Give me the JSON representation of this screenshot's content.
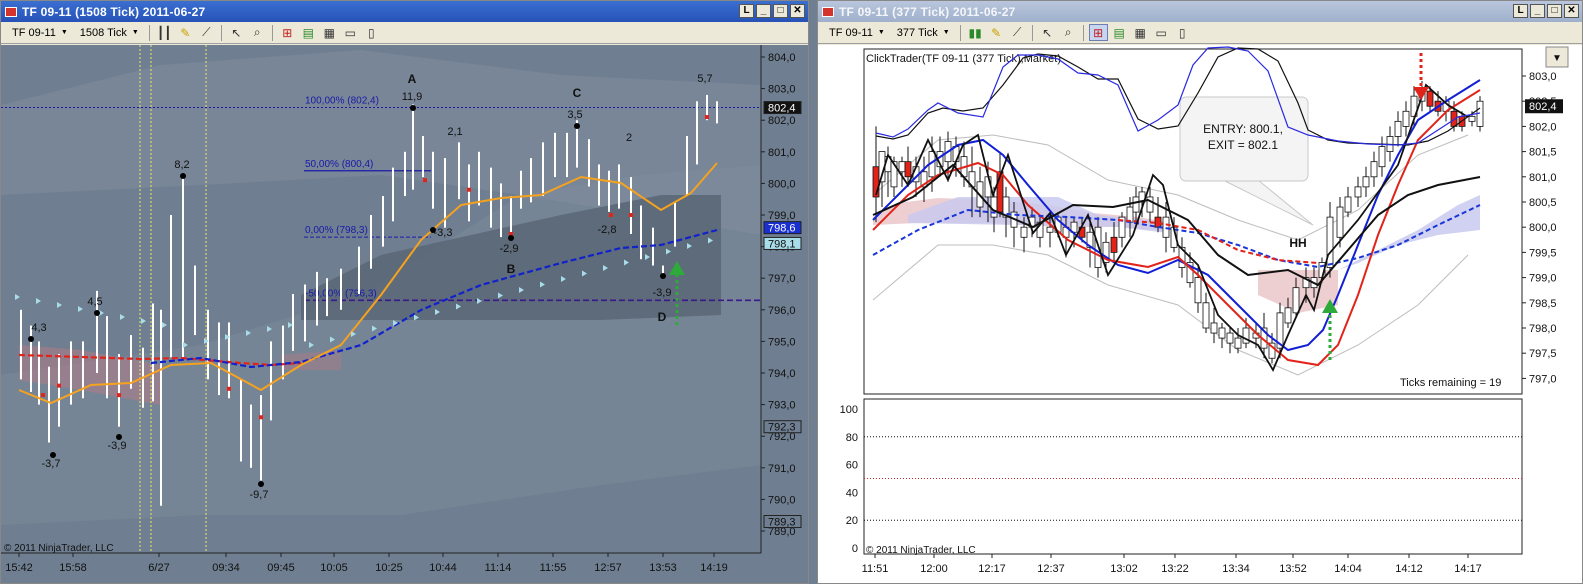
{
  "left_window": {
    "title": "TF 09-11 (1508 Tick)  2011-06-27",
    "toolbar": {
      "instrument": "TF 09-11",
      "period": "1508 Tick"
    },
    "copyright": "© 2011 NinjaTrader, LLC",
    "price_labels": [
      "804,0",
      "803,0",
      "802,0",
      "801,0",
      "800,0",
      "799,0",
      "798,0",
      "797,0",
      "796,0",
      "795,0",
      "794,0",
      "793,0",
      "792,0",
      "791,0",
      "790,0",
      "789,0"
    ],
    "price_boxes": {
      "last": "802,4",
      "blue": "798,6",
      "cyan": "798,1",
      "low1": "792,3",
      "low2": "789,3"
    },
    "time_labels": [
      "15:42",
      "15:58",
      "6/27",
      "09:34",
      "09:45",
      "10:05",
      "10:25",
      "10:44",
      "11:14",
      "11:55",
      "12:57",
      "13:53",
      "14:19"
    ],
    "fib_labels": [
      "100,00% (802,4)",
      "50,00% (800,4)",
      "0,00% (798,3)",
      "-50,00% (796,3)"
    ],
    "swing_labels": [
      "4,3",
      "-3,7",
      "4,5",
      "-3,9",
      "8,2",
      "-9,7",
      "11,9",
      "-3,3",
      "2,1",
      "-2,9",
      "3,5",
      "2",
      "-2,8",
      "-3,9",
      "5,7"
    ],
    "pattern_labels": {
      "a": "A",
      "b": "B",
      "c": "C",
      "d": "D"
    },
    "colors": {
      "bg": "#6f7f91",
      "band_dark": "#5b6878",
      "band_light": "#7f8d9d",
      "orange": "#f5a21f",
      "red_ma": "#e2231a",
      "blue_ma": "#1122cc",
      "purple": "#3a1a8a",
      "fib": "#1a1aa8"
    }
  },
  "right_window": {
    "title": "TF 09-11 (377 Tick)  2011-06-27",
    "toolbar": {
      "instrument": "TF 09-11",
      "period": "377 Tick"
    },
    "chart_title": "ClickTrader(TF 09-11 (377 Tick),Market)",
    "copyright": "© 2011 NinjaTrader, LLC",
    "callout": {
      "line1": "ENTRY: 800.1,",
      "line2": "EXIT = 802.1"
    },
    "hh_label": "HH",
    "ticks_remaining": "Ticks remaining = 19",
    "price_labels": [
      "803,0",
      "802,5",
      "802,0",
      "801,5",
      "801,0",
      "800,5",
      "800,0",
      "799,5",
      "799,0",
      "798,5",
      "798,0",
      "797,5",
      "797,0"
    ],
    "price_box": "802,4",
    "osc_labels": [
      "100",
      "80",
      "60",
      "40",
      "20",
      "0"
    ],
    "time_labels": [
      "11:51",
      "12:00",
      "12:17",
      "12:37",
      "13:02",
      "13:22",
      "13:34",
      "13:52",
      "14:04",
      "14:12",
      "14:17"
    ]
  }
}
